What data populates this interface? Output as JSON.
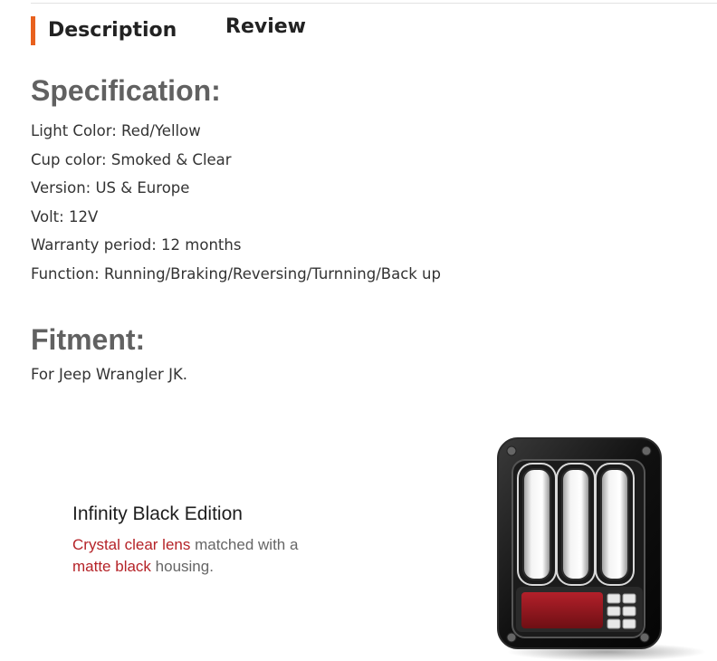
{
  "tabs": [
    {
      "label": "Description",
      "active": true
    },
    {
      "label": "Review",
      "active": false
    }
  ],
  "accent_color": "#e8611e",
  "specification": {
    "heading": "Specification:",
    "items": [
      "Light Color: Red/Yellow",
      "Cup color: Smoked & Clear",
      "Version: US & Europe",
      "Volt: 12V",
      "Warranty period: 12 months",
      "Function: Running/Braking/Reversing/Turnning/Back up"
    ]
  },
  "fitment": {
    "heading": "Fitment:",
    "text": "For Jeep Wrangler JK."
  },
  "banner": {
    "title": "Infinity Black Edition",
    "line1_highlight": "Crystal clear lens",
    "line1_rest": " matched with a",
    "line2_highlight": "matte black",
    "line2_rest": " housing.",
    "highlight_color": "#b52328"
  }
}
